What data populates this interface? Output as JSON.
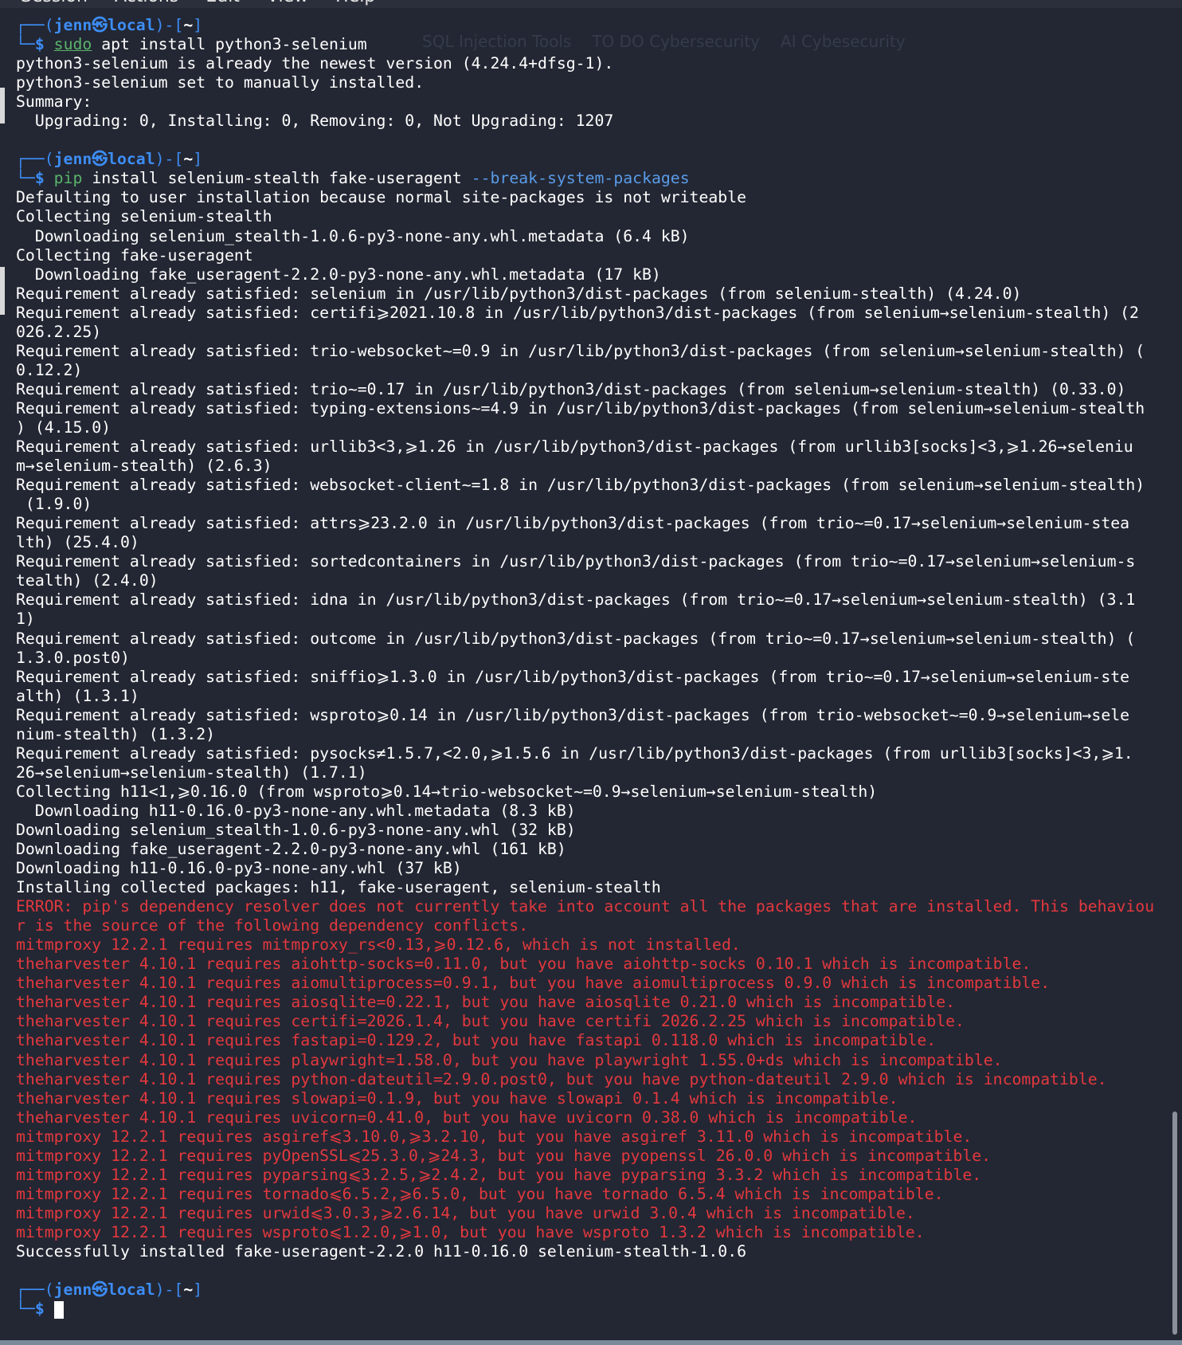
{
  "menu": [
    "Session",
    "Actions",
    "Edit",
    "View",
    "Help"
  ],
  "background_bookmarks": [
    "SQL Injection Tools",
    "TO DO Cybersecurity",
    "AI Cybesecurity"
  ],
  "prompt": {
    "top_left": "┌──(",
    "user_host": "jenn㉿local",
    "bracket_mid": ")-[",
    "dir": "~",
    "bracket_end": "]",
    "bottom_left": "└─",
    "dollar": "$"
  },
  "blocks": [
    {
      "command": {
        "name": "sudo",
        "args": " apt install python3-selenium"
      },
      "output": [
        {
          "text": "python3-selenium is already the newest version (4.24.4+dfsg-1).",
          "type": "normal"
        },
        {
          "text": "python3-selenium set to manually installed.",
          "type": "normal"
        },
        {
          "text": "Summary:",
          "type": "normal"
        },
        {
          "text": "  Upgrading: 0, Installing: 0, Removing: 0, Not Upgrading: 1207",
          "type": "normal"
        },
        {
          "text": "",
          "type": "normal"
        }
      ]
    },
    {
      "command": {
        "name": "pip",
        "args": " install selenium-stealth fake-useragent ",
        "option": "--break-system-packages"
      },
      "output": [
        {
          "text": "Defaulting to user installation because normal site-packages is not writeable",
          "type": "normal"
        },
        {
          "text": "Collecting selenium-stealth",
          "type": "normal"
        },
        {
          "text": "  Downloading selenium_stealth-1.0.6-py3-none-any.whl.metadata (6.4 kB)",
          "type": "normal"
        },
        {
          "text": "Collecting fake-useragent",
          "type": "normal"
        },
        {
          "text": "  Downloading fake_useragent-2.2.0-py3-none-any.whl.metadata (17 kB)",
          "type": "normal"
        },
        {
          "text": "Requirement already satisfied: selenium in /usr/lib/python3/dist-packages (from selenium-stealth) (4.24.0)",
          "type": "normal"
        },
        {
          "text": "Requirement already satisfied: certifi⩾2021.10.8 in /usr/lib/python3/dist-packages (from selenium→selenium-stealth) (2",
          "type": "normal"
        },
        {
          "text": "026.2.25)",
          "type": "normal"
        },
        {
          "text": "Requirement already satisfied: trio-websocket~=0.9 in /usr/lib/python3/dist-packages (from selenium→selenium-stealth) (",
          "type": "normal"
        },
        {
          "text": "0.12.2)",
          "type": "normal"
        },
        {
          "text": "Requirement already satisfied: trio~=0.17 in /usr/lib/python3/dist-packages (from selenium→selenium-stealth) (0.33.0)",
          "type": "normal"
        },
        {
          "text": "Requirement already satisfied: typing-extensions~=4.9 in /usr/lib/python3/dist-packages (from selenium→selenium-stealth",
          "type": "normal"
        },
        {
          "text": ") (4.15.0)",
          "type": "normal"
        },
        {
          "text": "Requirement already satisfied: urllib3<3,⩾1.26 in /usr/lib/python3/dist-packages (from urllib3[socks]<3,⩾1.26→seleniu",
          "type": "normal"
        },
        {
          "text": "m→selenium-stealth) (2.6.3)",
          "type": "normal"
        },
        {
          "text": "Requirement already satisfied: websocket-client~=1.8 in /usr/lib/python3/dist-packages (from selenium→selenium-stealth)",
          "type": "normal"
        },
        {
          "text": " (1.9.0)",
          "type": "normal"
        },
        {
          "text": "Requirement already satisfied: attrs⩾23.2.0 in /usr/lib/python3/dist-packages (from trio~=0.17→selenium→selenium-stea",
          "type": "normal"
        },
        {
          "text": "lth) (25.4.0)",
          "type": "normal"
        },
        {
          "text": "Requirement already satisfied: sortedcontainers in /usr/lib/python3/dist-packages (from trio~=0.17→selenium→selenium-s",
          "type": "normal"
        },
        {
          "text": "tealth) (2.4.0)",
          "type": "normal"
        },
        {
          "text": "Requirement already satisfied: idna in /usr/lib/python3/dist-packages (from trio~=0.17→selenium→selenium-stealth) (3.1",
          "type": "normal"
        },
        {
          "text": "1)",
          "type": "normal"
        },
        {
          "text": "Requirement already satisfied: outcome in /usr/lib/python3/dist-packages (from trio~=0.17→selenium→selenium-stealth) (",
          "type": "normal"
        },
        {
          "text": "1.3.0.post0)",
          "type": "normal"
        },
        {
          "text": "Requirement already satisfied: sniffio⩾1.3.0 in /usr/lib/python3/dist-packages (from trio~=0.17→selenium→selenium-ste",
          "type": "normal"
        },
        {
          "text": "alth) (1.3.1)",
          "type": "normal"
        },
        {
          "text": "Requirement already satisfied: wsproto⩾0.14 in /usr/lib/python3/dist-packages (from trio-websocket~=0.9→selenium→sele",
          "type": "normal"
        },
        {
          "text": "nium-stealth) (1.3.2)",
          "type": "normal"
        },
        {
          "text": "Requirement already satisfied: pysocks≠1.5.7,<2.0,⩾1.5.6 in /usr/lib/python3/dist-packages (from urllib3[socks]<3,⩾1.",
          "type": "normal"
        },
        {
          "text": "26→selenium→selenium-stealth) (1.7.1)",
          "type": "normal"
        },
        {
          "text": "Collecting h11<1,⩾0.16.0 (from wsproto⩾0.14→trio-websocket~=0.9→selenium→selenium-stealth)",
          "type": "normal"
        },
        {
          "text": "  Downloading h11-0.16.0-py3-none-any.whl.metadata (8.3 kB)",
          "type": "normal"
        },
        {
          "text": "Downloading selenium_stealth-1.0.6-py3-none-any.whl (32 kB)",
          "type": "normal"
        },
        {
          "text": "Downloading fake_useragent-2.2.0-py3-none-any.whl (161 kB)",
          "type": "normal"
        },
        {
          "text": "Downloading h11-0.16.0-py3-none-any.whl (37 kB)",
          "type": "normal"
        },
        {
          "text": "Installing collected packages: h11, fake-useragent, selenium-stealth",
          "type": "normal"
        },
        {
          "text": "ERROR: pip's dependency resolver does not currently take into account all the packages that are installed. This behaviou",
          "type": "error"
        },
        {
          "text": "r is the source of the following dependency conflicts.",
          "type": "error"
        },
        {
          "text": "mitmproxy 12.2.1 requires mitmproxy_rs<0.13,⩾0.12.6, which is not installed.",
          "type": "error"
        },
        {
          "text": "theharvester 4.10.1 requires aiohttp-socks=0.11.0, but you have aiohttp-socks 0.10.1 which is incompatible.",
          "type": "error"
        },
        {
          "text": "theharvester 4.10.1 requires aiomultiprocess=0.9.1, but you have aiomultiprocess 0.9.0 which is incompatible.",
          "type": "error"
        },
        {
          "text": "theharvester 4.10.1 requires aiosqlite=0.22.1, but you have aiosqlite 0.21.0 which is incompatible.",
          "type": "error"
        },
        {
          "text": "theharvester 4.10.1 requires certifi=2026.1.4, but you have certifi 2026.2.25 which is incompatible.",
          "type": "error"
        },
        {
          "text": "theharvester 4.10.1 requires fastapi=0.129.2, but you have fastapi 0.118.0 which is incompatible.",
          "type": "error"
        },
        {
          "text": "theharvester 4.10.1 requires playwright=1.58.0, but you have playwright 1.55.0+ds which is incompatible.",
          "type": "error"
        },
        {
          "text": "theharvester 4.10.1 requires python-dateutil=2.9.0.post0, but you have python-dateutil 2.9.0 which is incompatible.",
          "type": "error"
        },
        {
          "text": "theharvester 4.10.1 requires slowapi=0.1.9, but you have slowapi 0.1.4 which is incompatible.",
          "type": "error"
        },
        {
          "text": "theharvester 4.10.1 requires uvicorn=0.41.0, but you have uvicorn 0.38.0 which is incompatible.",
          "type": "error"
        },
        {
          "text": "mitmproxy 12.2.1 requires asgiref⩽3.10.0,⩾3.2.10, but you have asgiref 3.11.0 which is incompatible.",
          "type": "error"
        },
        {
          "text": "mitmproxy 12.2.1 requires pyOpenSSL⩽25.3.0,⩾24.3, but you have pyopenssl 26.0.0 which is incompatible.",
          "type": "error"
        },
        {
          "text": "mitmproxy 12.2.1 requires pyparsing⩽3.2.5,⩾2.4.2, but you have pyparsing 3.3.2 which is incompatible.",
          "type": "error"
        },
        {
          "text": "mitmproxy 12.2.1 requires tornado⩽6.5.2,⩾6.5.0, but you have tornado 6.5.4 which is incompatible.",
          "type": "error"
        },
        {
          "text": "mitmproxy 12.2.1 requires urwid⩽3.0.3,⩾2.6.14, but you have urwid 3.0.4 which is incompatible.",
          "type": "error"
        },
        {
          "text": "mitmproxy 12.2.1 requires wsproto⩽1.2.0,⩾1.0, but you have wsproto 1.3.2 which is incompatible.",
          "type": "error"
        },
        {
          "text": "Successfully installed fake-useragent-2.2.0 h11-0.16.0 selenium-stealth-1.0.6",
          "type": "normal"
        },
        {
          "text": "",
          "type": "normal"
        }
      ]
    }
  ],
  "colors": {
    "background": "#232733",
    "prompt": "#3d8df5",
    "command": "#5ab36b",
    "option": "#5a9be8",
    "error": "#e3383e",
    "text": "#ffffff"
  }
}
